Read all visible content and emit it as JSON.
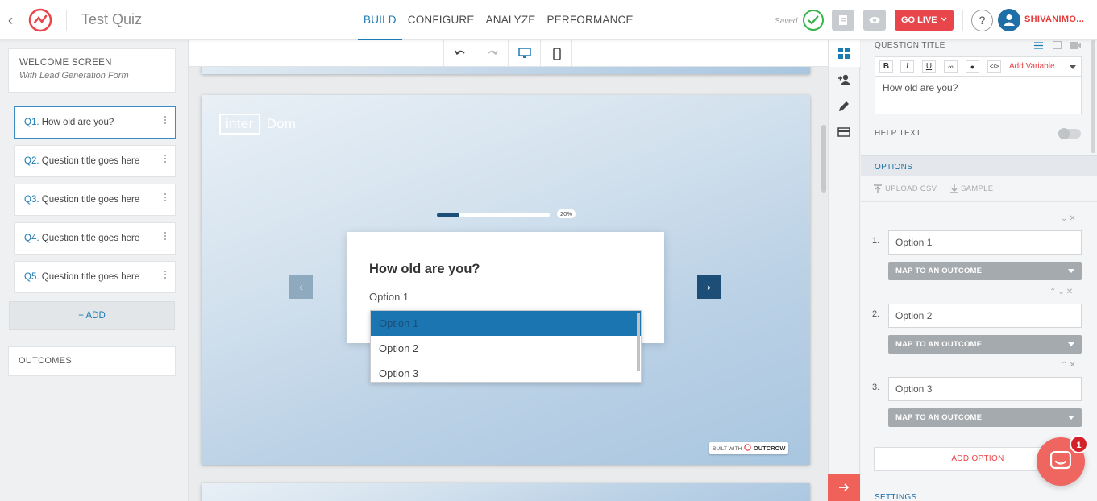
{
  "header": {
    "quiz_title": "Test Quiz",
    "tabs": [
      {
        "label": "BUILD",
        "active": true
      },
      {
        "label": "CONFIGURE",
        "active": false
      },
      {
        "label": "ANALYZE",
        "active": false
      },
      {
        "label": "PERFORMANCE",
        "active": false
      }
    ],
    "saved_label": "Saved",
    "go_live_label": "GO LIVE",
    "help_label": "?",
    "username": "SHIVANIMO..."
  },
  "sidebar": {
    "welcome": {
      "title": "WELCOME SCREEN",
      "subtitle": "With Lead Generation Form"
    },
    "questions": [
      {
        "num": "Q1.",
        "title": "How old are you?",
        "active": true
      },
      {
        "num": "Q2.",
        "title": "Question title goes here",
        "active": false
      },
      {
        "num": "Q3.",
        "title": "Question title goes here",
        "active": false
      },
      {
        "num": "Q4.",
        "title": "Question title goes here",
        "active": false
      },
      {
        "num": "Q5.",
        "title": "Question title goes here",
        "active": false
      }
    ],
    "add_label": "+ ADD",
    "outcomes_label": "OUTCOMES"
  },
  "canvas": {
    "brand_box": "inter",
    "brand_text": "Dom",
    "progress_label": "20%",
    "progress_fraction": 0.2,
    "question_title": "How old are you?",
    "selected_value": "Option 1",
    "dropdown_options": [
      "Option 1",
      "Option 2",
      "Option 3"
    ],
    "built_with": "BUILT WITH",
    "built_brand": "OUTCROW"
  },
  "panel": {
    "question_title_label": "QUESTION TITLE",
    "add_variable_label": "Add Variable",
    "question_text": "How old are you?",
    "help_text_label": "HELP TEXT",
    "help_text_enabled": false,
    "options_label": "OPTIONS",
    "upload_csv_label": "UPLOAD CSV",
    "sample_label": "SAMPLE",
    "options": [
      {
        "num": "1.",
        "value": "Option 1",
        "map_label": "MAP TO AN OUTCOME"
      },
      {
        "num": "2.",
        "value": "Option 2",
        "map_label": "MAP TO AN OUTCOME"
      },
      {
        "num": "3.",
        "value": "Option 3",
        "map_label": "MAP TO AN OUTCOME"
      }
    ],
    "add_option_label": "ADD OPTION",
    "settings_label": "SETTINGS"
  },
  "chat": {
    "badge_count": "1"
  },
  "colors": {
    "accent": "#1b7bb3",
    "brand_red": "#e8464a",
    "saved_green": "#36b34a",
    "slide_button": "#1c4e78"
  }
}
